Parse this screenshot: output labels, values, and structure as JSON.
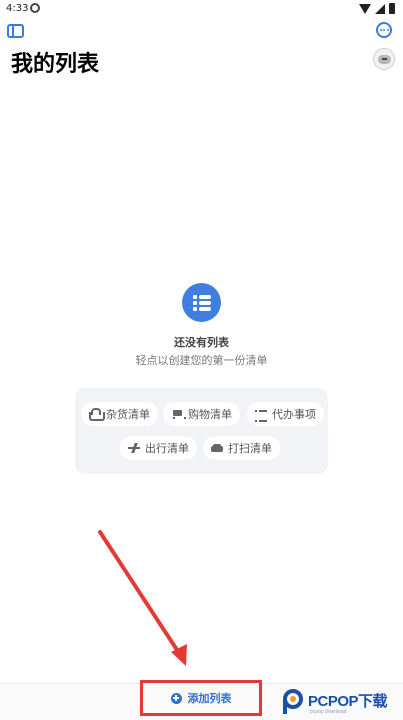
{
  "status_bar": {
    "time": "4:33"
  },
  "header": {
    "title": "我的列表"
  },
  "empty_state": {
    "title": "还没有列表",
    "subtitle": "轻点以创建您的第一份清单"
  },
  "templates": [
    {
      "label": "杂货清单",
      "icon": "basket-icon"
    },
    {
      "label": "购物清单",
      "icon": "cart-icon"
    },
    {
      "label": "代办事项",
      "icon": "list-icon"
    },
    {
      "label": "出行清单",
      "icon": "plane-icon"
    },
    {
      "label": "打扫清单",
      "icon": "sofa-icon"
    }
  ],
  "bottom_bar": {
    "add_button_label": "添加列表"
  },
  "watermark": {
    "brand": "PCPOP下载",
    "tagline": "pcpop download"
  },
  "colors": {
    "accent": "#3f7fe0",
    "annotation_red": "#e53935",
    "panel_bg": "#f1f3f6"
  }
}
